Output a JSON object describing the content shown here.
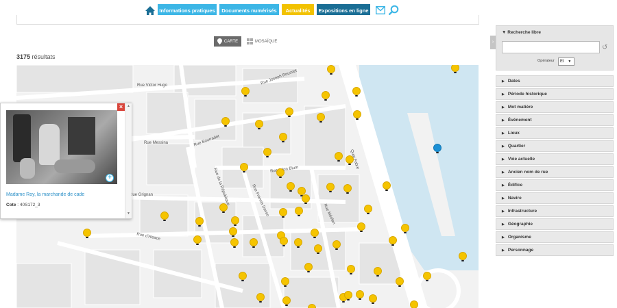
{
  "nav": {
    "informations_pratiques": "Informations pratiques",
    "documents_numerises": "Documents numérisés",
    "actualites": "Actualités",
    "expositions": "Expositions en ligne"
  },
  "view_toggle": {
    "carte": "CARTE",
    "mosaique": "MOSAÏQUE"
  },
  "results": {
    "count": "3175",
    "label": "résultats"
  },
  "map": {
    "streets": [
      "Rue Victor Hugo",
      "Rue Joseph Rousset",
      "Rue Messina",
      "Rue Bourradet",
      "Rue Léon Blum",
      "Rue Sainte",
      "Rue de la République",
      "Rue Francis Davso",
      "Rue Méolan",
      "Rue d'Alsace",
      "Quai Saint-Jean",
      "Quai Fabre",
      "Rue Grignan"
    ]
  },
  "popup": {
    "title": "Madame Roy, la marchande de cade",
    "cote_label": "Cote",
    "cote_value": ": 40S172_3",
    "close": "×",
    "plus": "+"
  },
  "sidebar": {
    "recherche_libre": "Recherche libre",
    "operateur_label": "Opérateur",
    "operateur_value": "Et",
    "facets": [
      "Dates",
      "Période historique",
      "Mot matière",
      "Événement",
      "Lieux",
      "Quartier",
      "Voie actuelle",
      "Ancien nom de rue",
      "Édifice",
      "Navire",
      "Infrastructure",
      "Géographie",
      "Organisme",
      "Personnage"
    ]
  },
  "colors": {
    "nav_blue": "#3cb6e6",
    "nav_yellow": "#f2c200",
    "nav_dark": "#1a6e95",
    "marker_yellow": "#f5c400",
    "marker_blue": "#1a90d6",
    "water": "#cfe6f2"
  }
}
